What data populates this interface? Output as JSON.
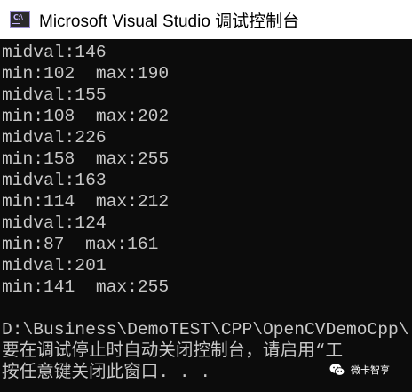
{
  "window": {
    "title": "Microsoft Visual Studio 调试控制台",
    "icon": "visual-studio-console-icon",
    "icon_glyph": "C:\\"
  },
  "console": {
    "lines": [
      "midval:146",
      "min:102  max:190",
      "midval:155",
      "min:108  max:202",
      "midval:226",
      "min:158  max:255",
      "midval:163",
      "min:114  max:212",
      "midval:124",
      "min:87  max:161",
      "midval:201",
      "min:141  max:255",
      "",
      "D:\\Business\\DemoTEST\\CPP\\OpenCVDemoCpp\\",
      "要在调试停止时自动关闭控制台，请启用“工",
      "按任意键关闭此窗口. . ."
    ]
  },
  "watermark": {
    "text": "微卡智享",
    "icon": "wechat-icon"
  },
  "colors": {
    "background": "#0c0c0c",
    "text": "#c8c8c8",
    "titlebar": "#ffffff"
  }
}
